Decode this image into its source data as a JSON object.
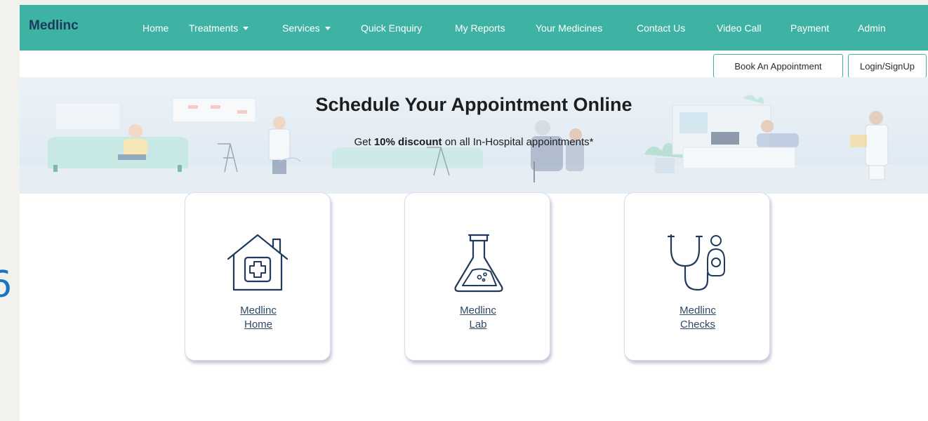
{
  "left_fragment": "6",
  "navbar": {
    "brand": "Medlinc",
    "items": [
      {
        "label": "Home"
      },
      {
        "label": "Treatments"
      },
      {
        "label": "Services"
      },
      {
        "label": "Quick Enquiry"
      },
      {
        "label": "My Reports"
      },
      {
        "label": "Your Medicines"
      },
      {
        "label": "Contact Us"
      },
      {
        "label": "Video Call"
      },
      {
        "label": "Payment"
      },
      {
        "label": "Admin"
      }
    ],
    "caret_icon": "caret-down-icon"
  },
  "actions": {
    "book_label": "Book An Appointment",
    "login_label": "Login/SignUp"
  },
  "banner": {
    "title": "Schedule Your Appointment Online",
    "sub_pre": "Get ",
    "sub_bold": "10% discount",
    "sub_post": " on all In-Hospital appointments*"
  },
  "cards": [
    {
      "line1": "Medlinc",
      "line2": "Home",
      "icon": "house-plus-icon"
    },
    {
      "line1": "Medlinc",
      "line2": "Lab",
      "icon": "flask-icon"
    },
    {
      "line1": "Medlinc",
      "line2": "Checks",
      "icon": "stethoscope-icon"
    }
  ],
  "colors": {
    "navbar": "#3fb3a3",
    "brand": "#1b3a5c",
    "icon": "#1f3a5a"
  }
}
